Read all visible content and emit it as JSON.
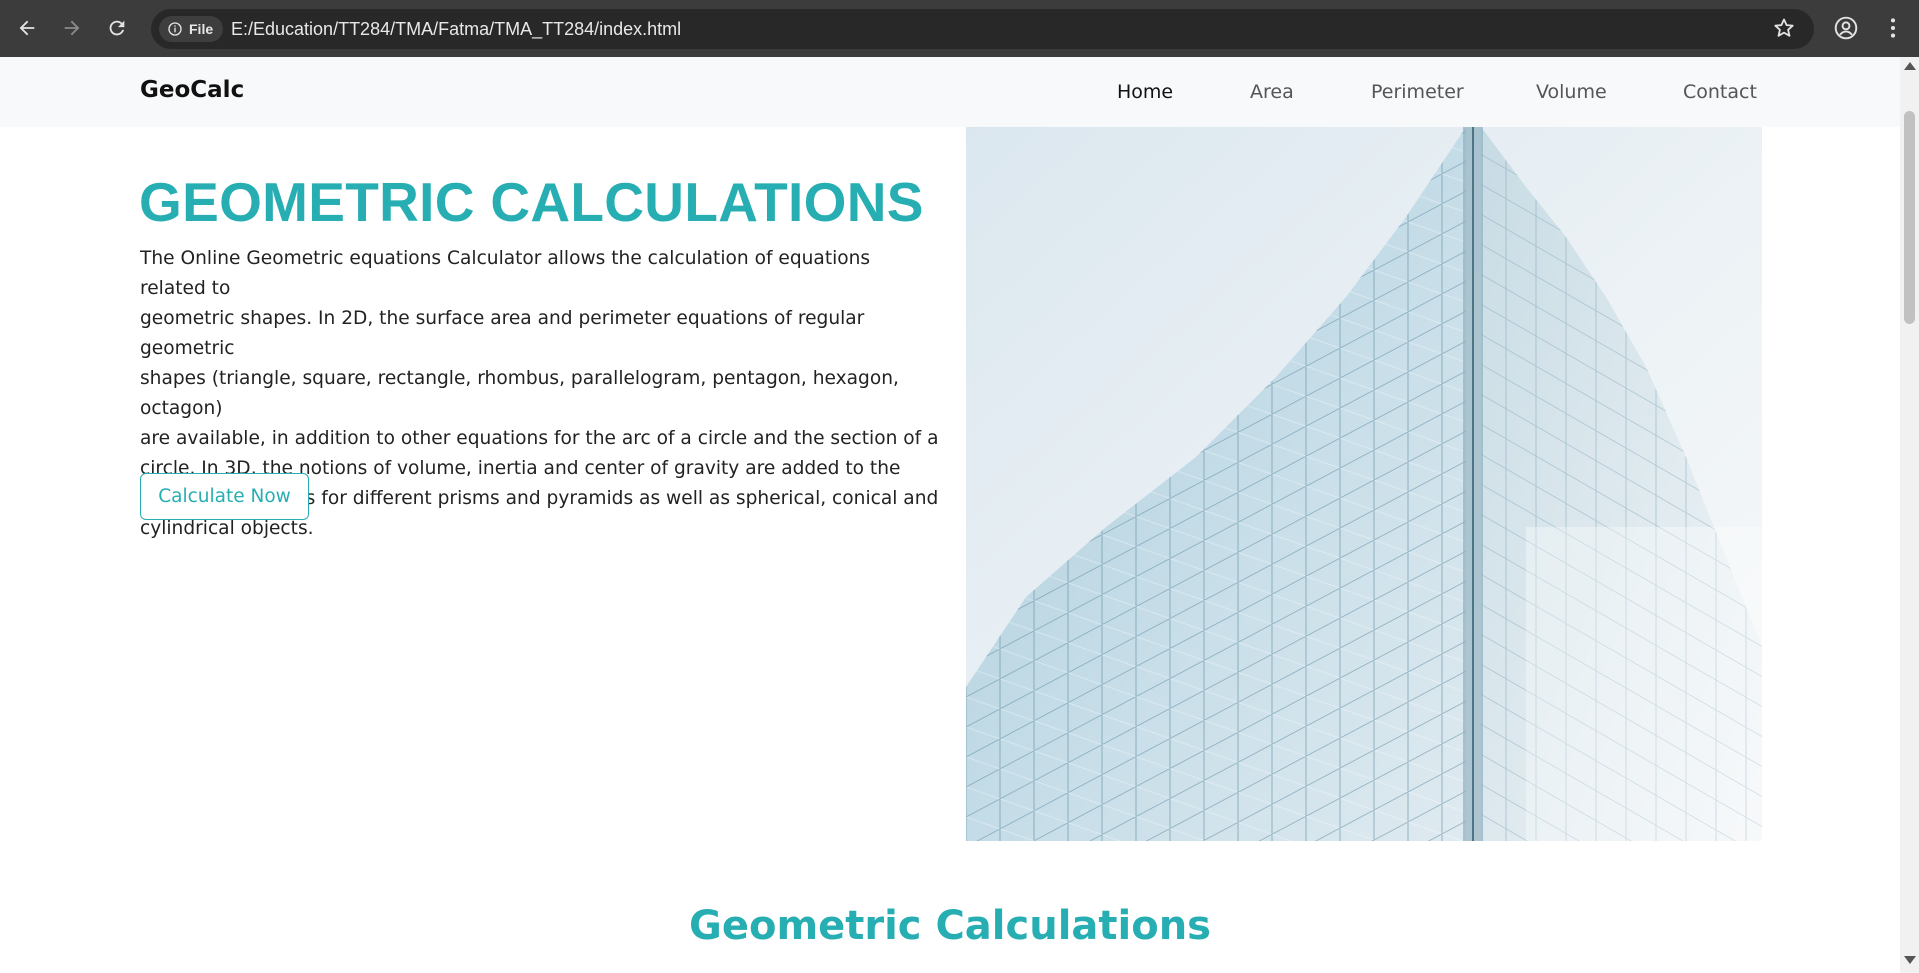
{
  "browser": {
    "site_chip_label": "File",
    "url": "E:/Education/TT284/TMA/Fatma/TMA_TT284/index.html",
    "icons": [
      "back-icon",
      "forward-icon",
      "reload-icon",
      "info-icon",
      "star-icon",
      "profile-icon",
      "menu-icon"
    ]
  },
  "site": {
    "brand": "GeoCalc",
    "nav": [
      {
        "label": "Home",
        "active": true
      },
      {
        "label": "Area",
        "active": false
      },
      {
        "label": "Perimeter",
        "active": false
      },
      {
        "label": "Volume",
        "active": false
      },
      {
        "label": "Contact",
        "active": false
      }
    ]
  },
  "hero": {
    "title": "GEOMETRIC CALCULATIONS",
    "paragraph_lines": [
      "The Online Geometric equations Calculator allows the calculation of equations related to",
      "geometric shapes. In 2D, the surface area and perimeter equations of regular geometric",
      "shapes (triangle, square, rectangle, rhombus, parallelogram, pentagon, hexagon, octagon)",
      "are available, in addition to other equations for the arc of a circle and the section of a",
      "circle. In 3D, the notions of volume, inertia and center of gravity are added to the",
      "calculation options for different prisms and pyramids as well as spherical, conical and",
      "cylindrical objects."
    ],
    "cta_label": "Calculate Now"
  },
  "section": {
    "title": "Geometric Calculations"
  },
  "colors": {
    "accent": "#27aeb2",
    "nav_bg": "#f8f9fa",
    "chrome_bg": "#3c3c3c",
    "urlbar_bg": "#282828"
  }
}
